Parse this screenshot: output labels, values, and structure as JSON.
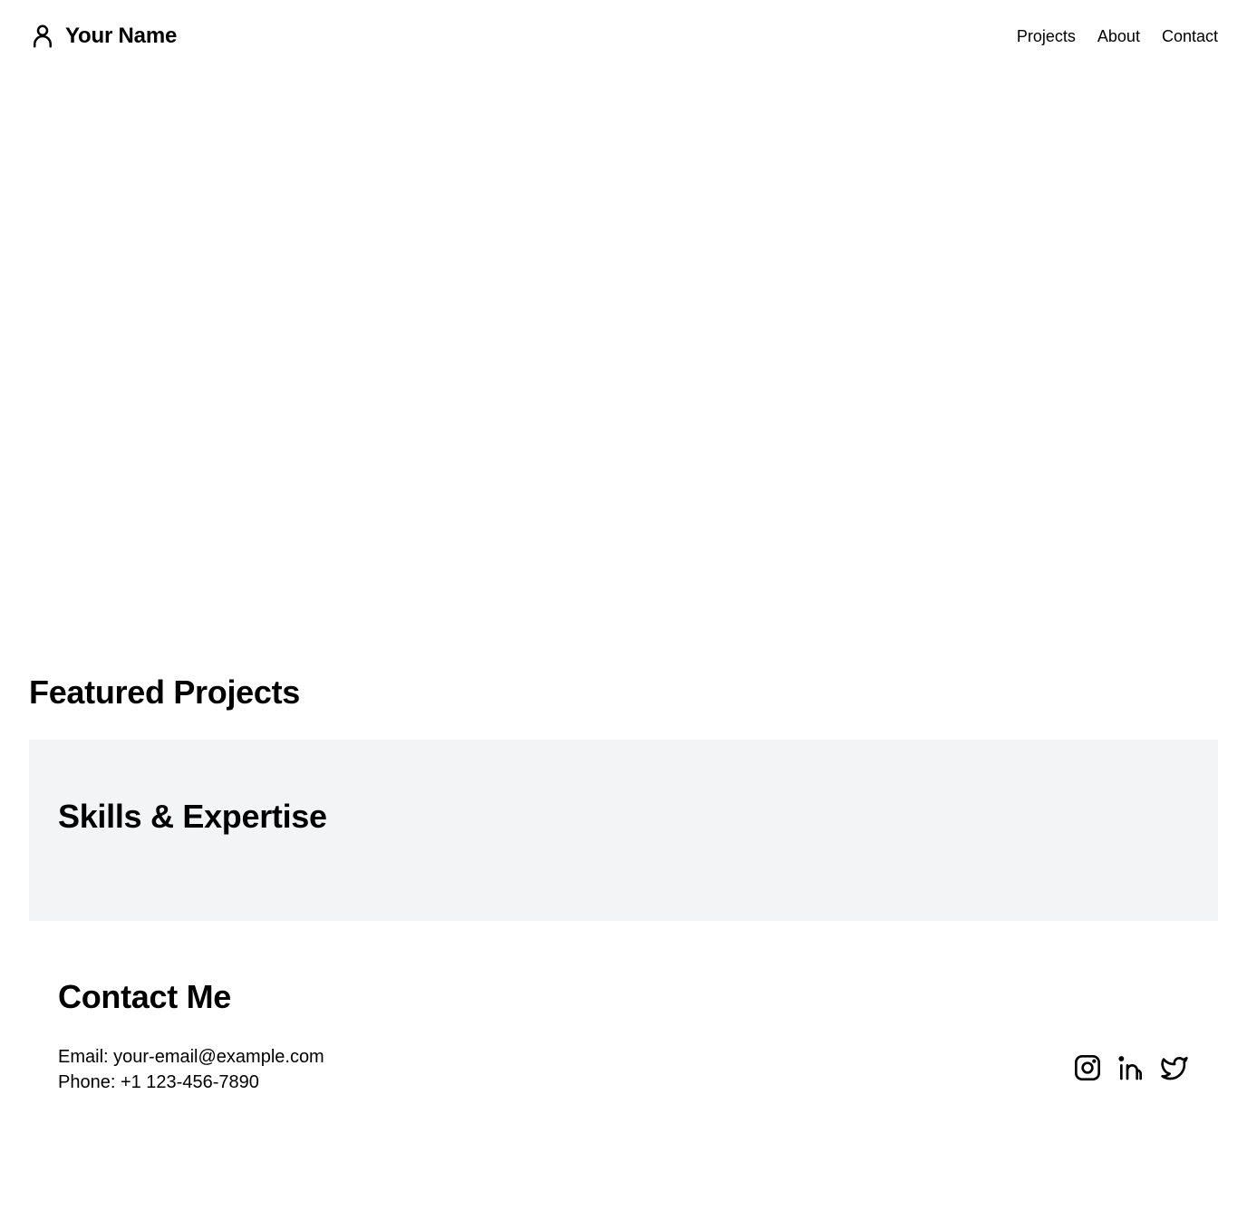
{
  "header": {
    "brand_icon": "user-icon",
    "name": "Your Name",
    "nav": [
      "Projects",
      "About",
      "Contact"
    ]
  },
  "projects": {
    "title": "Featured Projects"
  },
  "skills": {
    "title": "Skills & Expertise",
    "background": "#f3f4f6"
  },
  "contact": {
    "title": "Contact Me",
    "email": "Email: your-email@example.com",
    "phone": "Phone: +1 123-456-7890",
    "social_icons": [
      "instagram-icon",
      "linkedin-icon",
      "twitter-icon"
    ]
  }
}
